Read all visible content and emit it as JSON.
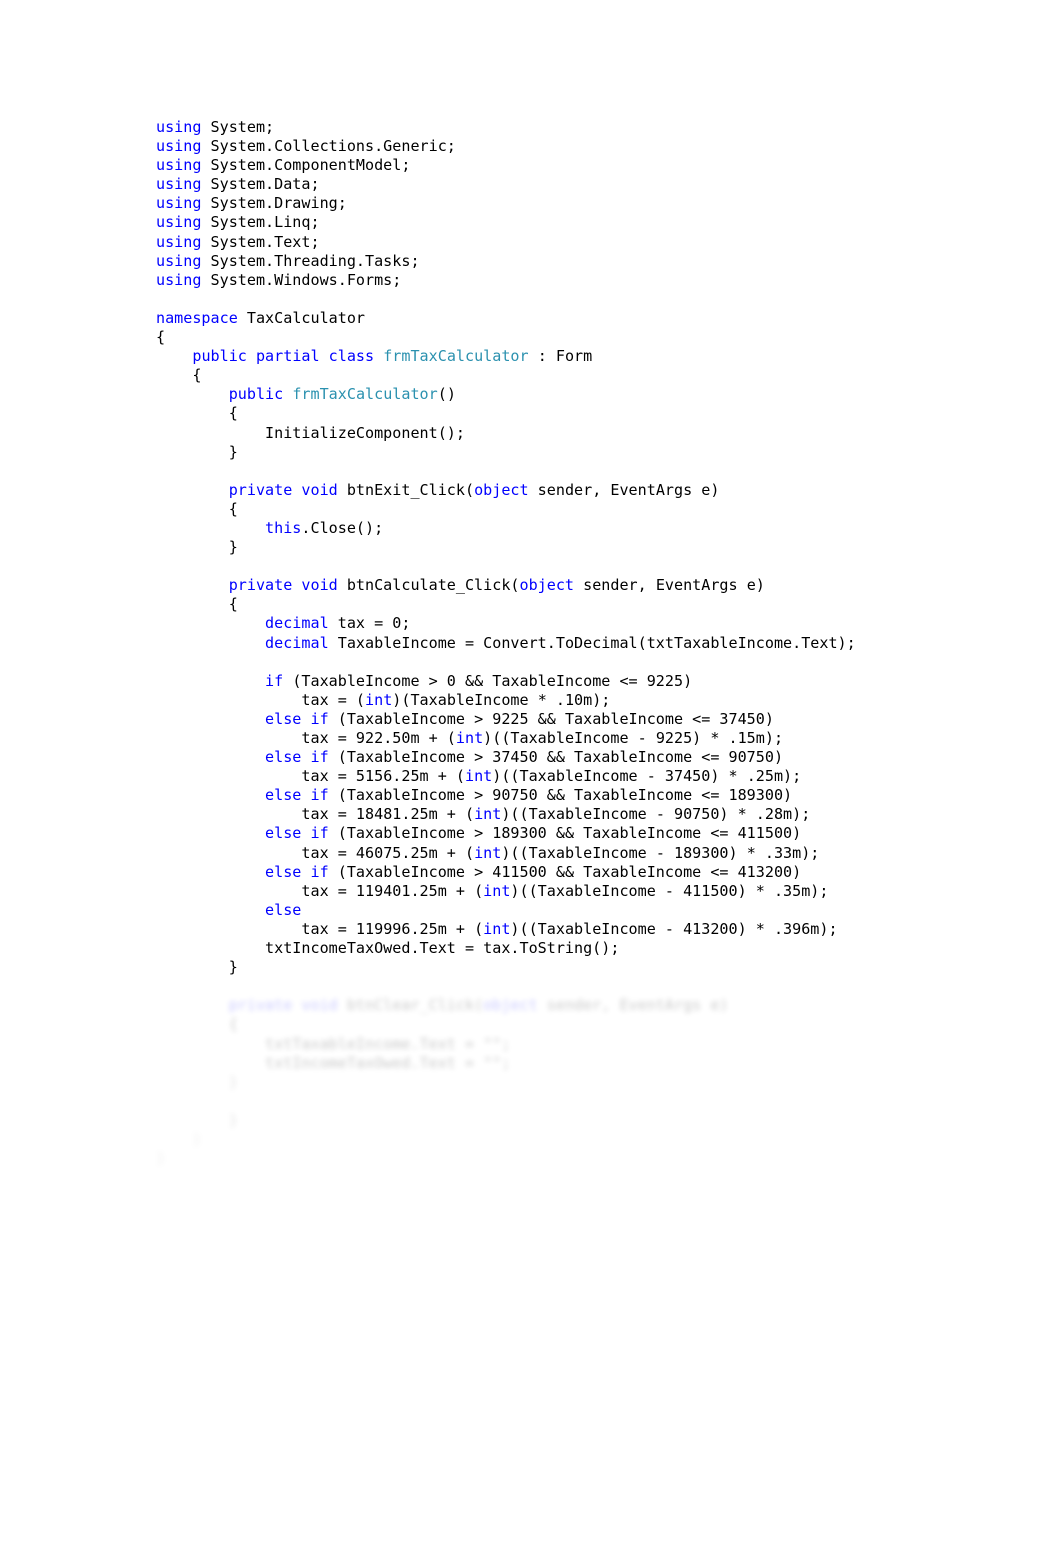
{
  "document": {
    "kind": "source-code-listing",
    "language": "C#",
    "namespace": "TaxCalculator",
    "class_name": "frmTaxCalculator",
    "base_class": "Form",
    "colors": {
      "background": "#ffffff",
      "plain_text": "#000000",
      "keyword": "#0000ff",
      "type_name": "#2b91af"
    }
  },
  "code": {
    "lines": [
      {
        "id": "l1",
        "indent": 0,
        "tokens": [
          {
            "t": "kw",
            "v": "using"
          },
          {
            "t": "txt",
            "v": " System;"
          }
        ]
      },
      {
        "id": "l2",
        "indent": 0,
        "tokens": [
          {
            "t": "kw",
            "v": "using"
          },
          {
            "t": "txt",
            "v": " System.Collections.Generic;"
          }
        ]
      },
      {
        "id": "l3",
        "indent": 0,
        "tokens": [
          {
            "t": "kw",
            "v": "using"
          },
          {
            "t": "txt",
            "v": " System.ComponentModel;"
          }
        ]
      },
      {
        "id": "l4",
        "indent": 0,
        "tokens": [
          {
            "t": "kw",
            "v": "using"
          },
          {
            "t": "txt",
            "v": " System.Data;"
          }
        ]
      },
      {
        "id": "l5",
        "indent": 0,
        "tokens": [
          {
            "t": "kw",
            "v": "using"
          },
          {
            "t": "txt",
            "v": " System.Drawing;"
          }
        ]
      },
      {
        "id": "l6",
        "indent": 0,
        "tokens": [
          {
            "t": "kw",
            "v": "using"
          },
          {
            "t": "txt",
            "v": " System.Linq;"
          }
        ]
      },
      {
        "id": "l7",
        "indent": 0,
        "tokens": [
          {
            "t": "kw",
            "v": "using"
          },
          {
            "t": "txt",
            "v": " System.Text;"
          }
        ]
      },
      {
        "id": "l8",
        "indent": 0,
        "tokens": [
          {
            "t": "kw",
            "v": "using"
          },
          {
            "t": "txt",
            "v": " System.Threading.Tasks;"
          }
        ]
      },
      {
        "id": "l9",
        "indent": 0,
        "tokens": [
          {
            "t": "kw",
            "v": "using"
          },
          {
            "t": "txt",
            "v": " System.Windows.Forms;"
          }
        ]
      },
      {
        "id": "l10",
        "indent": 0,
        "tokens": []
      },
      {
        "id": "l11",
        "indent": 0,
        "tokens": [
          {
            "t": "kw",
            "v": "namespace"
          },
          {
            "t": "txt",
            "v": " TaxCalculator"
          }
        ]
      },
      {
        "id": "l12",
        "indent": 0,
        "tokens": [
          {
            "t": "txt",
            "v": "{"
          }
        ]
      },
      {
        "id": "l13",
        "indent": 1,
        "tokens": [
          {
            "t": "kw",
            "v": "public partial class"
          },
          {
            "t": "txt",
            "v": " "
          },
          {
            "t": "type",
            "v": "frmTaxCalculator"
          },
          {
            "t": "txt",
            "v": " : Form"
          }
        ]
      },
      {
        "id": "l14",
        "indent": 1,
        "tokens": [
          {
            "t": "txt",
            "v": "{"
          }
        ]
      },
      {
        "id": "l15",
        "indent": 2,
        "tokens": [
          {
            "t": "kw",
            "v": "public"
          },
          {
            "t": "txt",
            "v": " "
          },
          {
            "t": "type",
            "v": "frmTaxCalculator"
          },
          {
            "t": "txt",
            "v": "()"
          }
        ]
      },
      {
        "id": "l16",
        "indent": 2,
        "tokens": [
          {
            "t": "txt",
            "v": "{"
          }
        ]
      },
      {
        "id": "l17",
        "indent": 3,
        "tokens": [
          {
            "t": "txt",
            "v": "InitializeComponent();"
          }
        ]
      },
      {
        "id": "l18",
        "indent": 2,
        "tokens": [
          {
            "t": "txt",
            "v": "}"
          }
        ]
      },
      {
        "id": "l19",
        "indent": 0,
        "tokens": []
      },
      {
        "id": "l20",
        "indent": 2,
        "tokens": [
          {
            "t": "kw",
            "v": "private void"
          },
          {
            "t": "txt",
            "v": " btnExit_Click("
          },
          {
            "t": "kw",
            "v": "object"
          },
          {
            "t": "txt",
            "v": " sender, EventArgs e)"
          }
        ]
      },
      {
        "id": "l21",
        "indent": 2,
        "tokens": [
          {
            "t": "txt",
            "v": "{"
          }
        ]
      },
      {
        "id": "l22",
        "indent": 3,
        "tokens": [
          {
            "t": "kw",
            "v": "this"
          },
          {
            "t": "txt",
            "v": ".Close();"
          }
        ]
      },
      {
        "id": "l23",
        "indent": 2,
        "tokens": [
          {
            "t": "txt",
            "v": "}"
          }
        ]
      },
      {
        "id": "l24",
        "indent": 0,
        "tokens": []
      },
      {
        "id": "l25",
        "indent": 2,
        "tokens": [
          {
            "t": "kw",
            "v": "private void"
          },
          {
            "t": "txt",
            "v": " btnCalculate_Click("
          },
          {
            "t": "kw",
            "v": "object"
          },
          {
            "t": "txt",
            "v": " sender, EventArgs e)"
          }
        ]
      },
      {
        "id": "l26",
        "indent": 2,
        "tokens": [
          {
            "t": "txt",
            "v": "{"
          }
        ]
      },
      {
        "id": "l27",
        "indent": 3,
        "tokens": [
          {
            "t": "kw",
            "v": "decimal"
          },
          {
            "t": "txt",
            "v": " tax = 0;"
          }
        ]
      },
      {
        "id": "l28",
        "indent": 3,
        "tokens": [
          {
            "t": "kw",
            "v": "decimal"
          },
          {
            "t": "txt",
            "v": " TaxableIncome = Convert.ToDecimal(txtTaxableIncome.Text);"
          }
        ]
      },
      {
        "id": "l29",
        "indent": 0,
        "tokens": []
      },
      {
        "id": "l30",
        "indent": 3,
        "tokens": [
          {
            "t": "kw",
            "v": "if"
          },
          {
            "t": "txt",
            "v": " (TaxableIncome > 0 && TaxableIncome <= 9225)"
          }
        ]
      },
      {
        "id": "l31",
        "indent": 4,
        "tokens": [
          {
            "t": "txt",
            "v": "tax = ("
          },
          {
            "t": "kw",
            "v": "int"
          },
          {
            "t": "txt",
            "v": ")(TaxableIncome * .10m);"
          }
        ]
      },
      {
        "id": "l32",
        "indent": 3,
        "tokens": [
          {
            "t": "kw",
            "v": "else if"
          },
          {
            "t": "txt",
            "v": " (TaxableIncome > 9225 && TaxableIncome <= 37450)"
          }
        ]
      },
      {
        "id": "l33",
        "indent": 4,
        "tokens": [
          {
            "t": "txt",
            "v": "tax = 922.50m + ("
          },
          {
            "t": "kw",
            "v": "int"
          },
          {
            "t": "txt",
            "v": ")((TaxableIncome - 9225) * .15m);"
          }
        ]
      },
      {
        "id": "l34",
        "indent": 3,
        "tokens": [
          {
            "t": "kw",
            "v": "else if"
          },
          {
            "t": "txt",
            "v": " (TaxableIncome > 37450 && TaxableIncome <= 90750)"
          }
        ]
      },
      {
        "id": "l35",
        "indent": 4,
        "tokens": [
          {
            "t": "txt",
            "v": "tax = 5156.25m + ("
          },
          {
            "t": "kw",
            "v": "int"
          },
          {
            "t": "txt",
            "v": ")((TaxableIncome - 37450) * .25m);"
          }
        ]
      },
      {
        "id": "l36",
        "indent": 3,
        "tokens": [
          {
            "t": "kw",
            "v": "else if"
          },
          {
            "t": "txt",
            "v": " (TaxableIncome > 90750 && TaxableIncome <= 189300)"
          }
        ]
      },
      {
        "id": "l37",
        "indent": 4,
        "tokens": [
          {
            "t": "txt",
            "v": "tax = 18481.25m + ("
          },
          {
            "t": "kw",
            "v": "int"
          },
          {
            "t": "txt",
            "v": ")((TaxableIncome - 90750) * .28m);"
          }
        ]
      },
      {
        "id": "l38",
        "indent": 3,
        "tokens": [
          {
            "t": "kw",
            "v": "else if"
          },
          {
            "t": "txt",
            "v": " (TaxableIncome > 189300 && TaxableIncome <= 411500)"
          }
        ]
      },
      {
        "id": "l39",
        "indent": 4,
        "tokens": [
          {
            "t": "txt",
            "v": "tax = 46075.25m + ("
          },
          {
            "t": "kw",
            "v": "int"
          },
          {
            "t": "txt",
            "v": ")((TaxableIncome - 189300) * .33m);"
          }
        ]
      },
      {
        "id": "l40",
        "indent": 3,
        "tokens": [
          {
            "t": "kw",
            "v": "else if"
          },
          {
            "t": "txt",
            "v": " (TaxableIncome > 411500 && TaxableIncome <= 413200)"
          }
        ]
      },
      {
        "id": "l41",
        "indent": 4,
        "tokens": [
          {
            "t": "txt",
            "v": "tax = 119401.25m + ("
          },
          {
            "t": "kw",
            "v": "int"
          },
          {
            "t": "txt",
            "v": ")((TaxableIncome - 411500) * .35m);"
          }
        ]
      },
      {
        "id": "l42",
        "indent": 3,
        "tokens": [
          {
            "t": "kw",
            "v": "else"
          }
        ]
      },
      {
        "id": "l43",
        "indent": 4,
        "tokens": [
          {
            "t": "txt",
            "v": "tax = 119996.25m + ("
          },
          {
            "t": "kw",
            "v": "int"
          },
          {
            "t": "txt",
            "v": ")((TaxableIncome - 413200) * .396m);"
          }
        ]
      },
      {
        "id": "l44",
        "indent": 3,
        "tokens": [
          {
            "t": "txt",
            "v": "txtIncomeTaxOwed.Text = tax.ToString();"
          }
        ]
      },
      {
        "id": "l45",
        "indent": 2,
        "tokens": [
          {
            "t": "txt",
            "v": "}"
          }
        ]
      },
      {
        "id": "l46",
        "indent": 0,
        "tokens": []
      },
      {
        "id": "l47",
        "indent": 2,
        "fade": "faded",
        "tokens": [
          {
            "t": "kw",
            "v": "private void"
          },
          {
            "t": "txt",
            "v": " btnClear_Click("
          },
          {
            "t": "kw",
            "v": "object"
          },
          {
            "t": "txt",
            "v": " sender, EventArgs e)"
          }
        ]
      },
      {
        "id": "l48",
        "indent": 2,
        "fade": "faded",
        "tokens": [
          {
            "t": "txt",
            "v": "{"
          }
        ]
      },
      {
        "id": "l49",
        "indent": 3,
        "fade": "faded",
        "tokens": [
          {
            "t": "txt",
            "v": "txtTaxableIncome.Text = \"\";"
          }
        ]
      },
      {
        "id": "l50",
        "indent": 3,
        "fade": "faded",
        "tokens": [
          {
            "t": "txt",
            "v": "txtIncomeTaxOwed.Text = \"\";"
          }
        ]
      },
      {
        "id": "l51",
        "indent": 2,
        "fade": "faded-2",
        "tokens": [
          {
            "t": "txt",
            "v": "}"
          }
        ]
      },
      {
        "id": "l52",
        "indent": 0,
        "fade": "faded-3",
        "tokens": []
      },
      {
        "id": "l53",
        "indent": 2,
        "fade": "faded-2",
        "tokens": [
          {
            "t": "txt",
            "v": "}"
          }
        ]
      },
      {
        "id": "l54",
        "indent": 1,
        "fade": "faded-3",
        "tokens": [
          {
            "t": "txt",
            "v": "}"
          }
        ]
      },
      {
        "id": "l55",
        "indent": 0,
        "fade": "faded-3",
        "tokens": [
          {
            "t": "txt",
            "v": "}"
          }
        ]
      }
    ]
  }
}
